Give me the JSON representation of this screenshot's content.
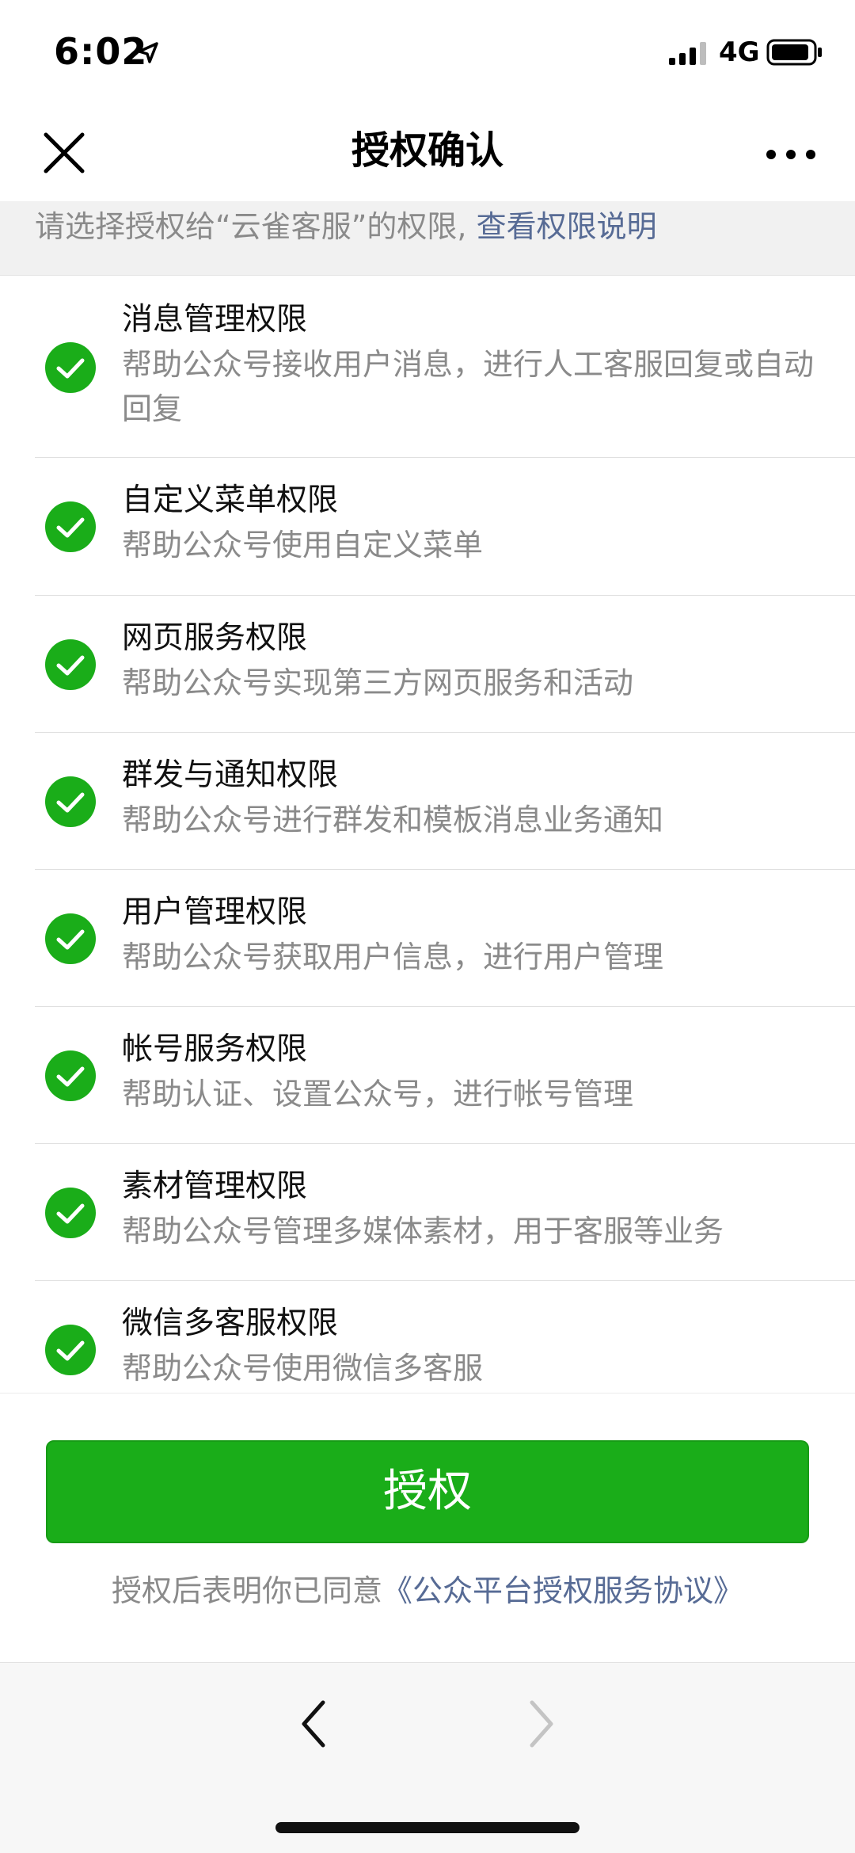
{
  "status_bar": {
    "time": "6:02",
    "network": "4G"
  },
  "nav": {
    "title": "授权确认"
  },
  "hint": {
    "text": "请选择授权给“云雀客服”的权限,",
    "link": "查看权限说明"
  },
  "permissions": [
    {
      "title": "消息管理权限",
      "desc": "帮助公众号接收用户消息，进行人工客服回复或自动回复"
    },
    {
      "title": "自定义菜单权限",
      "desc": "帮助公众号使用自定义菜单"
    },
    {
      "title": "网页服务权限",
      "desc": "帮助公众号实现第三方网页服务和活动"
    },
    {
      "title": "群发与通知权限",
      "desc": "帮助公众号进行群发和模板消息业务通知"
    },
    {
      "title": "用户管理权限",
      "desc": "帮助公众号获取用户信息，进行用户管理"
    },
    {
      "title": "帐号服务权限",
      "desc": "帮助认证、设置公众号，进行帐号管理"
    },
    {
      "title": "素材管理权限",
      "desc": "帮助公众号管理多媒体素材，用于客服等业务"
    },
    {
      "title": "微信多客服权限",
      "desc": "帮助公众号使用微信多客服"
    }
  ],
  "footer": {
    "authorize_label": "授权",
    "agreement_prefix": "授权后表明你已同意",
    "agreement_link": "《公众平台授权服务协议》"
  },
  "colors": {
    "accent_green": "#1aad19",
    "link_blue": "#576b95",
    "muted_gray": "#8a8a8a"
  },
  "icons": {
    "close": "close-icon",
    "more": "more-dots-icon",
    "check": "check-circle-icon",
    "back": "chevron-left-icon",
    "forward": "chevron-right-icon"
  }
}
